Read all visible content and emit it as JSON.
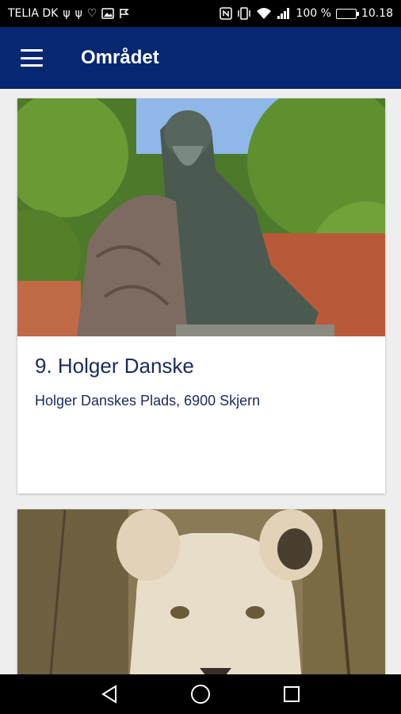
{
  "status_bar": {
    "carrier": "TELIA DK",
    "battery": "100 %",
    "time": "10.18",
    "left_icons": [
      "usb-icon",
      "usb-icon",
      "heart-icon",
      "image-icon",
      "flag-icon"
    ],
    "right_icons": [
      "nfc-icon",
      "vibrate-icon",
      "wifi-icon",
      "signal-icon",
      "battery-icon"
    ],
    "battery_level": 1.0
  },
  "app_bar": {
    "title": "Området",
    "background": "#072770"
  },
  "cards": [
    {
      "title": "9. Holger Danske",
      "address": "Holger Danskes Plads, 6900 Skjern",
      "image": "statue-photo"
    },
    {
      "title": "",
      "address": "",
      "image": "lion-photo"
    }
  ],
  "nav_bar": {
    "buttons": [
      "back-icon",
      "home-icon",
      "recents-icon"
    ]
  }
}
